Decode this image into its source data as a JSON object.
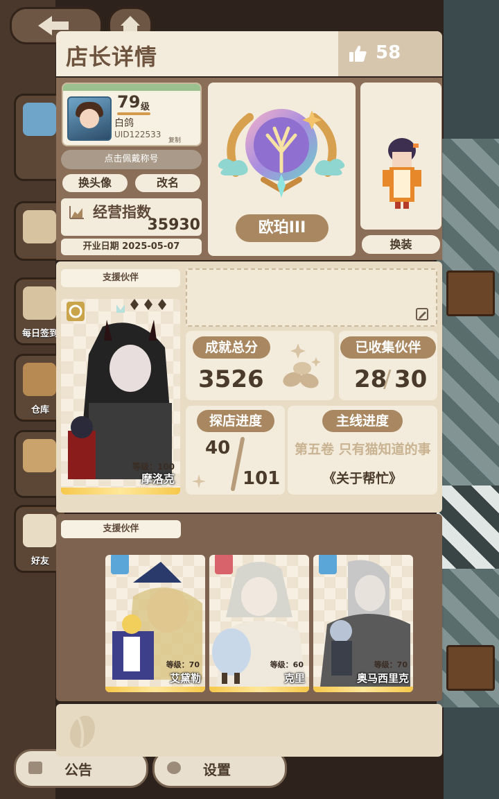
{
  "header": {
    "title": "店长详情",
    "likes": "58"
  },
  "profile": {
    "level": "79",
    "level_suffix": "级",
    "name": "白鸽",
    "uid": "UID122533",
    "copy_label": "复制",
    "title_button": "点击佩戴称号",
    "change_avatar": "换头像",
    "rename": "改名"
  },
  "business": {
    "label": "经营指数",
    "value": "35930",
    "open_date": "开业日期 2025-05-07"
  },
  "rank": {
    "name": "欧珀III"
  },
  "outfit": {
    "change_button": "换装"
  },
  "support_partner": {
    "tag": "支援伙伴",
    "level": "等级：100",
    "name": "摩洛克"
  },
  "stats": {
    "achievement_label": "成就总分",
    "achievement_value": "3526",
    "collected_label": "已收集伙伴",
    "collected_value": "28",
    "collected_total": "30",
    "explore_label": "探店进度",
    "explore_value": "40",
    "explore_total": "101",
    "main_label": "主线进度",
    "main_chapter": "第五卷 只有猫知道的事",
    "main_subtitle": "《关于帮忙》"
  },
  "partners": {
    "tag": "支援伙伴",
    "items": [
      {
        "level": "等级：70",
        "name": "艾黛勒",
        "role_color": "#5aa6d8"
      },
      {
        "level": "等级：60",
        "name": "克里",
        "role_color": "#d9636b"
      },
      {
        "level": "等级：70",
        "name": "奥马西里克",
        "role_color": "#5aa6d8"
      }
    ]
  },
  "bottom": {
    "notice": "公告",
    "settings": "设置"
  },
  "side_menu": {
    "daily": "每日签到",
    "storage": "仓库",
    "friends": "好友"
  },
  "colors": {
    "panel": "#f3ecdc",
    "accent": "#a98760",
    "frame": "#8a6e57"
  }
}
